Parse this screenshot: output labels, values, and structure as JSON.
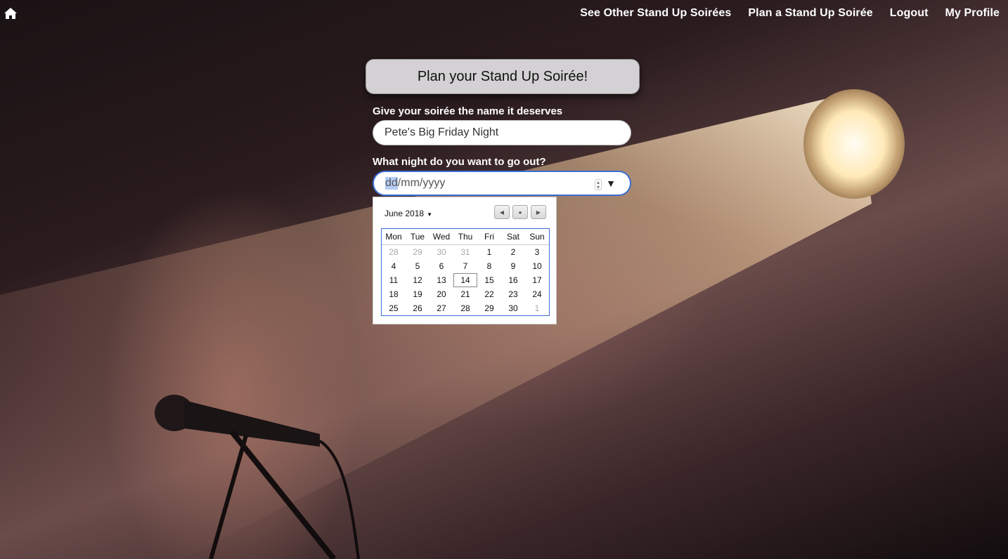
{
  "nav": {
    "home_icon": "home-icon",
    "links": [
      "See Other Stand Up Soirées",
      "Plan a Stand Up Soirée",
      "Logout",
      "My Profile"
    ]
  },
  "form": {
    "title": "Plan your Stand Up Soirée!",
    "name_label": "Give your soirée the name it deserves",
    "name_value": "Pete's Big Friday Night",
    "date_label": "What night do you want to go out?",
    "date_dd": "dd",
    "date_rest": "/mm/yyyy"
  },
  "calendar": {
    "month": "June 2018",
    "weekdays": [
      "Mon",
      "Tue",
      "Wed",
      "Thu",
      "Fri",
      "Sat",
      "Sun"
    ],
    "weeks": [
      [
        "28",
        "29",
        "30",
        "31",
        "1",
        "2",
        "3"
      ],
      [
        "4",
        "5",
        "6",
        "7",
        "8",
        "9",
        "10"
      ],
      [
        "11",
        "12",
        "13",
        "14",
        "15",
        "16",
        "17"
      ],
      [
        "18",
        "19",
        "20",
        "21",
        "22",
        "23",
        "24"
      ],
      [
        "25",
        "26",
        "27",
        "28",
        "29",
        "30",
        "1"
      ]
    ],
    "today": "14"
  },
  "colors": {
    "accent": "#3b6ed5",
    "header_bg": "#d3d1d3"
  }
}
